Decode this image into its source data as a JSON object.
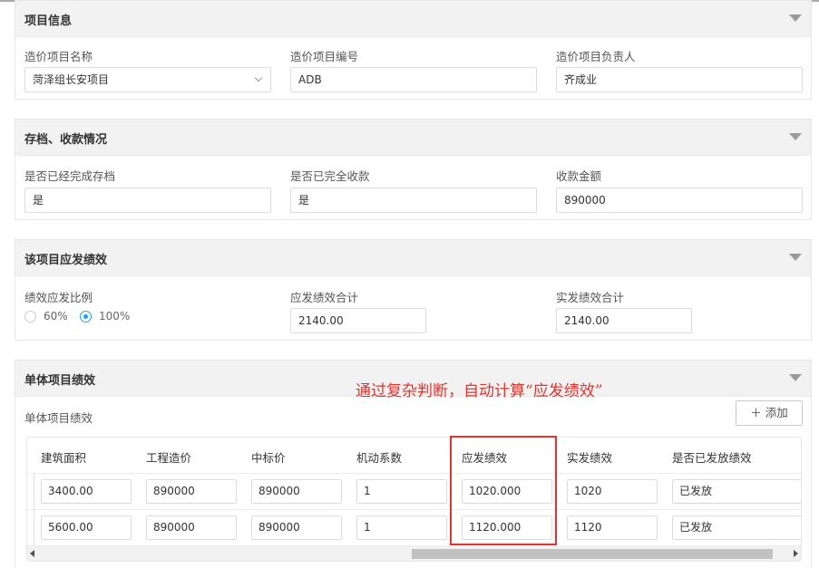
{
  "project_info": {
    "title": "项目信息",
    "fields": [
      {
        "label": "造价项目名称",
        "value": "菏泽组长安项目"
      },
      {
        "label": "造价项目编号",
        "value": "ADB"
      },
      {
        "label": "造价项目负责人",
        "value": "齐成业"
      }
    ]
  },
  "archive": {
    "title": "存档、收款情况",
    "fields": [
      {
        "label": "是否已经完成存档",
        "value": "是"
      },
      {
        "label": "是否已完全收款",
        "value": "是"
      },
      {
        "label": "收款金额",
        "value": "890000"
      }
    ]
  },
  "performance": {
    "title": "该项目应发绩效",
    "ratio_label": "绩效应发比例",
    "ratio_options": [
      {
        "label": "60%",
        "selected": false
      },
      {
        "label": "100%",
        "selected": true
      }
    ],
    "due_total_label": "应发绩效合计",
    "due_total_value": "2140.00",
    "paid_total_label": "实发绩效合计",
    "paid_total_value": "2140.00"
  },
  "unit_performance": {
    "title": "单体项目绩效",
    "subtitle": "单体项目绩效",
    "annotation": "通过复杂判断，自动计算“应发绩效”",
    "add_button": "添加",
    "columns": [
      "建筑面积",
      "工程造价",
      "中标价",
      "机动系数",
      "应发绩效",
      "实发绩效",
      "是否已发放绩效"
    ],
    "rows": [
      [
        "3400.00",
        "890000",
        "890000",
        "1",
        "1020.000",
        "1020",
        "已发放"
      ],
      [
        "5600.00",
        "890000",
        "890000",
        "1",
        "1120.000",
        "1120",
        "已发放"
      ]
    ]
  },
  "colors": {
    "accent": "#1e9fff",
    "annotation": "#e8322d"
  },
  "icons": {
    "collapse": "caret-down-icon",
    "add": "plus-icon",
    "select": "chevron-down-icon"
  }
}
